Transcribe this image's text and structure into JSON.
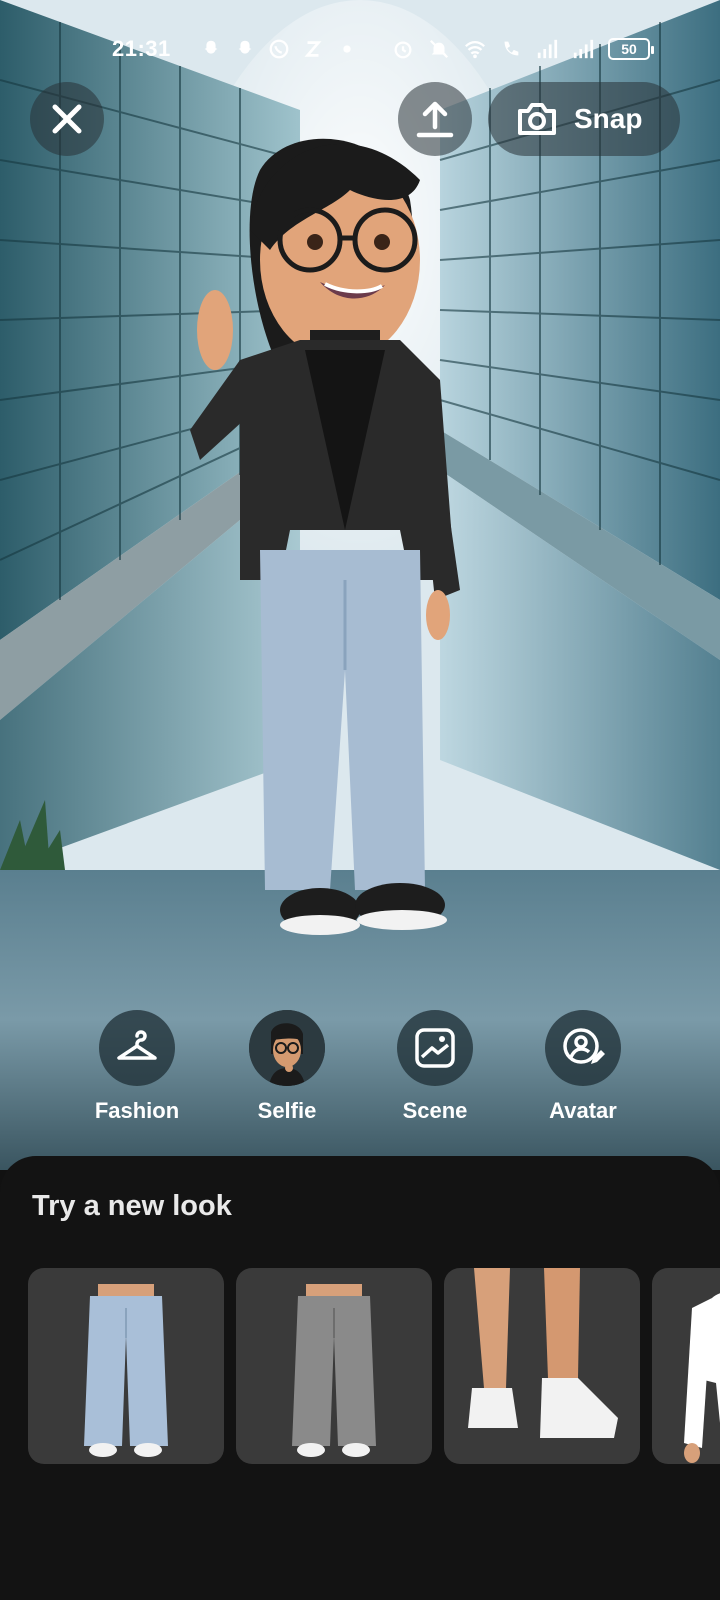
{
  "status_bar": {
    "time": "21:31",
    "battery": "50",
    "left_icons": [
      "snapchat-icon",
      "snapchat-icon",
      "whatsapp-icon",
      "z-app-icon",
      "dot-icon"
    ],
    "right_icons": [
      "alarm-icon",
      "mute-icon",
      "wifi-icon",
      "volte-call-icon",
      "signal-icon",
      "signal-icon"
    ]
  },
  "top_bar": {
    "snap_label": "Snap"
  },
  "actions": [
    {
      "label": "Fashion",
      "icon": "hanger-icon"
    },
    {
      "label": "Selfie",
      "icon": "selfie-avatar-icon"
    },
    {
      "label": "Scene",
      "icon": "image-icon"
    },
    {
      "label": "Avatar",
      "icon": "avatar-edit-icon"
    }
  ],
  "sheet": {
    "title": "Try a new look",
    "items": [
      {
        "name": "light blue baggy jeans",
        "color": "#a9bfd8"
      },
      {
        "name": "grey baggy jeans",
        "color": "#8a8a8a"
      },
      {
        "name": "white sneakers",
        "color": "#f2f2f2"
      },
      {
        "name": "white long sleeve top",
        "color": "#ffffff"
      }
    ]
  },
  "colors": {
    "sheet_bg": "#131313",
    "card_bg": "#3a3a3a",
    "button_overlay": "#283237"
  }
}
